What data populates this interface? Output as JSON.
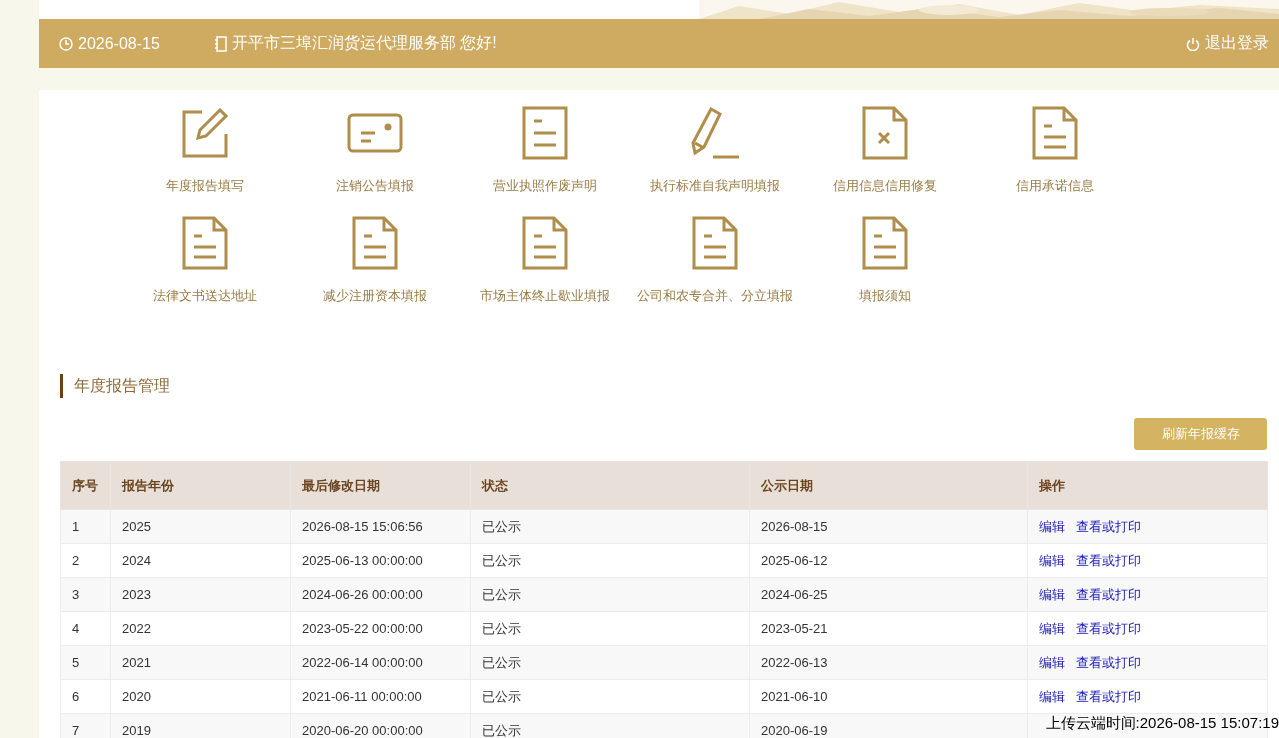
{
  "header": {
    "date": "2026-08-15",
    "greeting": "开平市三埠汇润货运代理服务部 您好!",
    "logout": "退出登录"
  },
  "shortcuts": [
    {
      "label": "年度报告填写",
      "kind": "edit"
    },
    {
      "label": "注销公告填报",
      "kind": "card"
    },
    {
      "label": "营业执照作废声明",
      "kind": "doc"
    },
    {
      "label": "执行标准自我声明填报",
      "kind": "pencil"
    },
    {
      "label": "信用信息信用修复",
      "kind": "doc-x"
    },
    {
      "label": "信用承诺信息",
      "kind": "form"
    },
    {
      "label": "法律文书送达地址",
      "kind": "form"
    },
    {
      "label": "减少注册资本填报",
      "kind": "form"
    },
    {
      "label": "市场主体终止歇业填报",
      "kind": "form"
    },
    {
      "label": "公司和农专合并、分立填报",
      "kind": "form"
    },
    {
      "label": "填报须知",
      "kind": "form"
    }
  ],
  "section": {
    "title": "年度报告管理",
    "refresh_button": "刷新年报缓存"
  },
  "table": {
    "columns": [
      "序号",
      "报告年份",
      "最后修改日期",
      "状态",
      "公示日期",
      "操作"
    ],
    "rows": [
      {
        "cells": [
          "1",
          "2025",
          "2026-08-15 15:06:56",
          "已公示",
          "2026-08-15"
        ],
        "actions": [
          "编辑",
          "查看或打印"
        ]
      },
      {
        "cells": [
          "2",
          "2024",
          "2025-06-13 00:00:00",
          "已公示",
          "2025-06-12"
        ],
        "actions": [
          "编辑",
          "查看或打印"
        ]
      },
      {
        "cells": [
          "3",
          "2023",
          "2024-06-26 00:00:00",
          "已公示",
          "2024-06-25"
        ],
        "actions": [
          "编辑",
          "查看或打印"
        ]
      },
      {
        "cells": [
          "4",
          "2022",
          "2023-05-22 00:00:00",
          "已公示",
          "2023-05-21"
        ],
        "actions": [
          "编辑",
          "查看或打印"
        ]
      },
      {
        "cells": [
          "5",
          "2021",
          "2022-06-14 00:00:00",
          "已公示",
          "2022-06-13"
        ],
        "actions": [
          "编辑",
          "查看或打印"
        ]
      },
      {
        "cells": [
          "6",
          "2020",
          "2021-06-11 00:00:00",
          "已公示",
          "2021-06-10"
        ],
        "actions": [
          "编辑",
          "查看或打印"
        ]
      },
      {
        "cells": [
          "7",
          "2019",
          "2020-06-20 00:00:00",
          "已公示",
          "2020-06-19"
        ],
        "actions": []
      }
    ]
  },
  "upload_time": "上传云端时间:2026-08-15 15:07:19"
}
